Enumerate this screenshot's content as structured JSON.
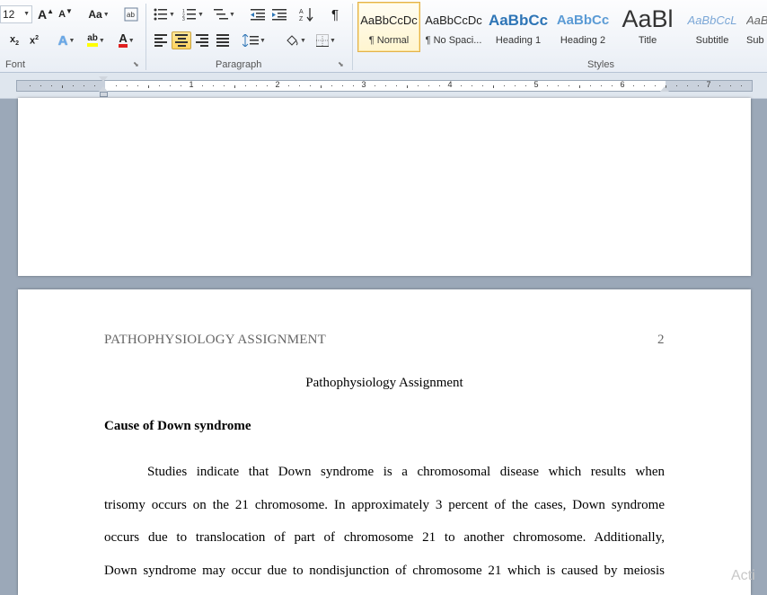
{
  "font_group": {
    "font_size": "12",
    "label": "Font",
    "change_case_label": "Aa",
    "grow_font_glyph": "A",
    "shrink_font_glyph": "A",
    "font_color_glyph": "A"
  },
  "paragraph_group": {
    "label": "Paragraph",
    "pilcrow": "¶"
  },
  "styles_group": {
    "label": "Styles",
    "items": [
      {
        "sample": "AaBbCcDc",
        "name": "¶ Normal",
        "selected": true
      },
      {
        "sample": "AaBbCcDc",
        "name": "¶ No Spaci..."
      },
      {
        "sample": "AaBbCc",
        "name": "Heading 1"
      },
      {
        "sample": "AaBbCc",
        "name": "Heading 2"
      },
      {
        "sample": "AaBl",
        "name": "Title"
      },
      {
        "sample": "AaBbCcL",
        "name": "Subtitle"
      },
      {
        "sample": "AaB",
        "name": "Sub"
      }
    ]
  },
  "ruler": {
    "numbers": [
      "1",
      "2",
      "3",
      "4",
      "5",
      "6",
      "7"
    ]
  },
  "document": {
    "running_head": "PATHOPHYSIOLOGY ASSIGNMENT",
    "page_number": "2",
    "title": "Pathophysiology Assignment",
    "heading": "Cause of Down syndrome",
    "paragraph_lines": [
      "Studies indicate that Down syndrome is a chromosomal disease which results when",
      "trisomy occurs on the 21 chromosome. In approximately 3 percent of the cases, Down syndrome",
      "occurs due to translocation of part of chromosome 21 to another chromosome. Additionally,",
      "Down syndrome may occur due to nondisjunction of chromosome 21 which is caused by meiosis"
    ]
  },
  "watermark": "Acti",
  "colors": {
    "highlight": "#ffff00",
    "font_color": "#e02020",
    "active_button": "#ffd35c",
    "heading_blue": "#2e75b6"
  }
}
